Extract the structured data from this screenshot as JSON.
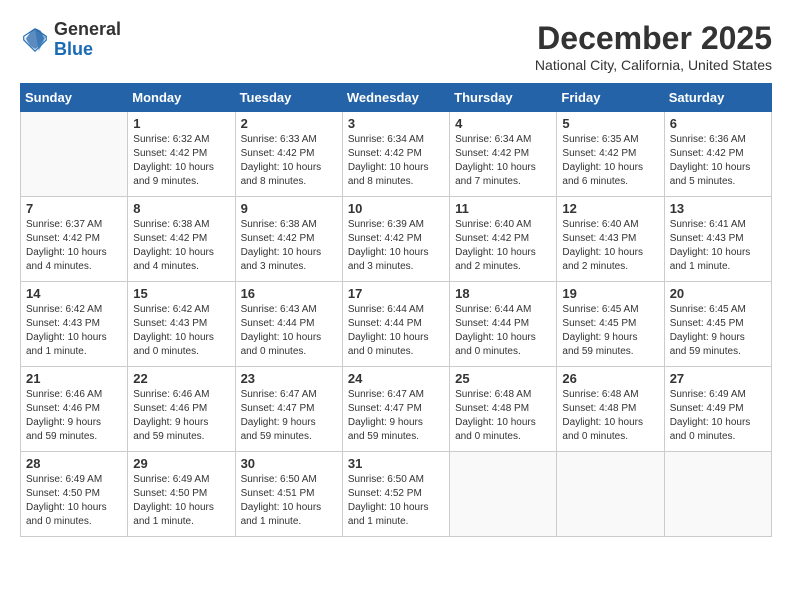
{
  "header": {
    "logo_line1": "General",
    "logo_line2": "Blue",
    "month_title": "December 2025",
    "location": "National City, California, United States"
  },
  "days_of_week": [
    "Sunday",
    "Monday",
    "Tuesday",
    "Wednesday",
    "Thursday",
    "Friday",
    "Saturday"
  ],
  "weeks": [
    [
      {
        "day": "",
        "content": ""
      },
      {
        "day": "1",
        "content": "Sunrise: 6:32 AM\nSunset: 4:42 PM\nDaylight: 10 hours\nand 9 minutes."
      },
      {
        "day": "2",
        "content": "Sunrise: 6:33 AM\nSunset: 4:42 PM\nDaylight: 10 hours\nand 8 minutes."
      },
      {
        "day": "3",
        "content": "Sunrise: 6:34 AM\nSunset: 4:42 PM\nDaylight: 10 hours\nand 8 minutes."
      },
      {
        "day": "4",
        "content": "Sunrise: 6:34 AM\nSunset: 4:42 PM\nDaylight: 10 hours\nand 7 minutes."
      },
      {
        "day": "5",
        "content": "Sunrise: 6:35 AM\nSunset: 4:42 PM\nDaylight: 10 hours\nand 6 minutes."
      },
      {
        "day": "6",
        "content": "Sunrise: 6:36 AM\nSunset: 4:42 PM\nDaylight: 10 hours\nand 5 minutes."
      }
    ],
    [
      {
        "day": "7",
        "content": "Sunrise: 6:37 AM\nSunset: 4:42 PM\nDaylight: 10 hours\nand 4 minutes."
      },
      {
        "day": "8",
        "content": "Sunrise: 6:38 AM\nSunset: 4:42 PM\nDaylight: 10 hours\nand 4 minutes."
      },
      {
        "day": "9",
        "content": "Sunrise: 6:38 AM\nSunset: 4:42 PM\nDaylight: 10 hours\nand 3 minutes."
      },
      {
        "day": "10",
        "content": "Sunrise: 6:39 AM\nSunset: 4:42 PM\nDaylight: 10 hours\nand 3 minutes."
      },
      {
        "day": "11",
        "content": "Sunrise: 6:40 AM\nSunset: 4:42 PM\nDaylight: 10 hours\nand 2 minutes."
      },
      {
        "day": "12",
        "content": "Sunrise: 6:40 AM\nSunset: 4:43 PM\nDaylight: 10 hours\nand 2 minutes."
      },
      {
        "day": "13",
        "content": "Sunrise: 6:41 AM\nSunset: 4:43 PM\nDaylight: 10 hours\nand 1 minute."
      }
    ],
    [
      {
        "day": "14",
        "content": "Sunrise: 6:42 AM\nSunset: 4:43 PM\nDaylight: 10 hours\nand 1 minute."
      },
      {
        "day": "15",
        "content": "Sunrise: 6:42 AM\nSunset: 4:43 PM\nDaylight: 10 hours\nand 0 minutes."
      },
      {
        "day": "16",
        "content": "Sunrise: 6:43 AM\nSunset: 4:44 PM\nDaylight: 10 hours\nand 0 minutes."
      },
      {
        "day": "17",
        "content": "Sunrise: 6:44 AM\nSunset: 4:44 PM\nDaylight: 10 hours\nand 0 minutes."
      },
      {
        "day": "18",
        "content": "Sunrise: 6:44 AM\nSunset: 4:44 PM\nDaylight: 10 hours\nand 0 minutes."
      },
      {
        "day": "19",
        "content": "Sunrise: 6:45 AM\nSunset: 4:45 PM\nDaylight: 9 hours\nand 59 minutes."
      },
      {
        "day": "20",
        "content": "Sunrise: 6:45 AM\nSunset: 4:45 PM\nDaylight: 9 hours\nand 59 minutes."
      }
    ],
    [
      {
        "day": "21",
        "content": "Sunrise: 6:46 AM\nSunset: 4:46 PM\nDaylight: 9 hours\nand 59 minutes."
      },
      {
        "day": "22",
        "content": "Sunrise: 6:46 AM\nSunset: 4:46 PM\nDaylight: 9 hours\nand 59 minutes."
      },
      {
        "day": "23",
        "content": "Sunrise: 6:47 AM\nSunset: 4:47 PM\nDaylight: 9 hours\nand 59 minutes."
      },
      {
        "day": "24",
        "content": "Sunrise: 6:47 AM\nSunset: 4:47 PM\nDaylight: 9 hours\nand 59 minutes."
      },
      {
        "day": "25",
        "content": "Sunrise: 6:48 AM\nSunset: 4:48 PM\nDaylight: 10 hours\nand 0 minutes."
      },
      {
        "day": "26",
        "content": "Sunrise: 6:48 AM\nSunset: 4:48 PM\nDaylight: 10 hours\nand 0 minutes."
      },
      {
        "day": "27",
        "content": "Sunrise: 6:49 AM\nSunset: 4:49 PM\nDaylight: 10 hours\nand 0 minutes."
      }
    ],
    [
      {
        "day": "28",
        "content": "Sunrise: 6:49 AM\nSunset: 4:50 PM\nDaylight: 10 hours\nand 0 minutes."
      },
      {
        "day": "29",
        "content": "Sunrise: 6:49 AM\nSunset: 4:50 PM\nDaylight: 10 hours\nand 1 minute."
      },
      {
        "day": "30",
        "content": "Sunrise: 6:50 AM\nSunset: 4:51 PM\nDaylight: 10 hours\nand 1 minute."
      },
      {
        "day": "31",
        "content": "Sunrise: 6:50 AM\nSunset: 4:52 PM\nDaylight: 10 hours\nand 1 minute."
      },
      {
        "day": "",
        "content": ""
      },
      {
        "day": "",
        "content": ""
      },
      {
        "day": "",
        "content": ""
      }
    ]
  ]
}
